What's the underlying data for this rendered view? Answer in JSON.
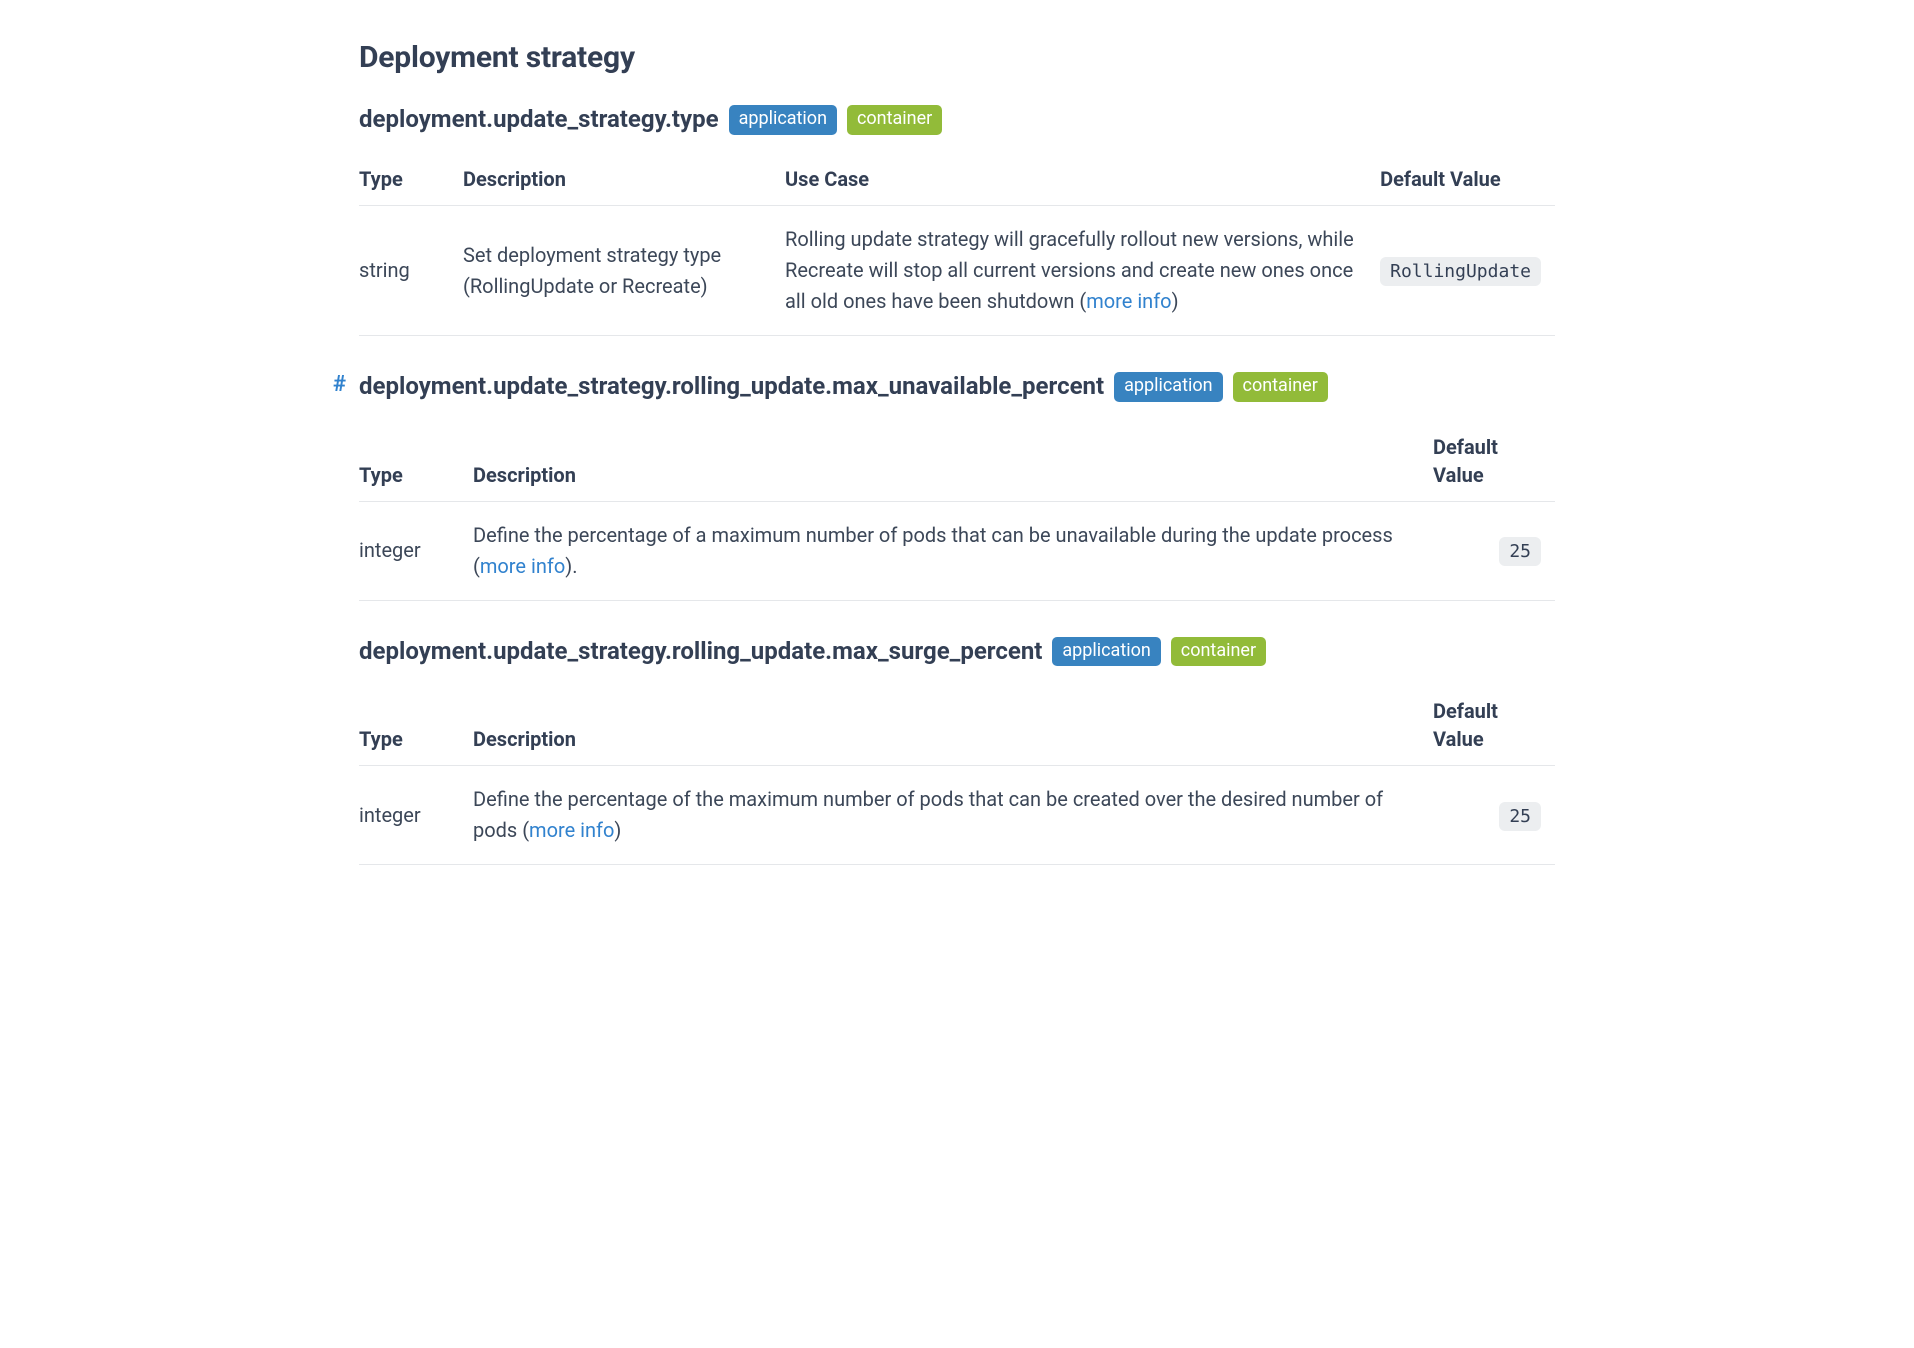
{
  "section_title": "Deployment strategy",
  "badges": {
    "application": "application",
    "container": "container"
  },
  "table_headers": {
    "type": "Type",
    "description": "Description",
    "use_case": "Use Case",
    "default_value": "Default Value"
  },
  "more_info_label": "more info",
  "configs": [
    {
      "key": "deployment.update_strategy.type",
      "show_anchor": false,
      "has_use_case": true,
      "type": "string",
      "description": "Set deployment strategy type (RollingUpdate or Recreate)",
      "use_case_pre": "Rolling update strategy will gracefully rollout new versions, while Recreate will stop all current versions and create new ones once all old ones have been shutdown (",
      "use_case_post": ")",
      "default": "RollingUpdate"
    },
    {
      "key": "deployment.update_strategy.rolling_update.max_unavailable_percent",
      "show_anchor": true,
      "has_use_case": false,
      "type": "integer",
      "description_pre": "Define the percentage of a maximum number of pods that can be unavailable during the update process (",
      "description_post": ").",
      "default": "25"
    },
    {
      "key": "deployment.update_strategy.rolling_update.max_surge_percent",
      "show_anchor": false,
      "has_use_case": false,
      "type": "integer",
      "description_pre": "Define the percentage of the maximum number of pods that can be created over the desired number of pods (",
      "description_post": ")",
      "default": "25"
    }
  ]
}
